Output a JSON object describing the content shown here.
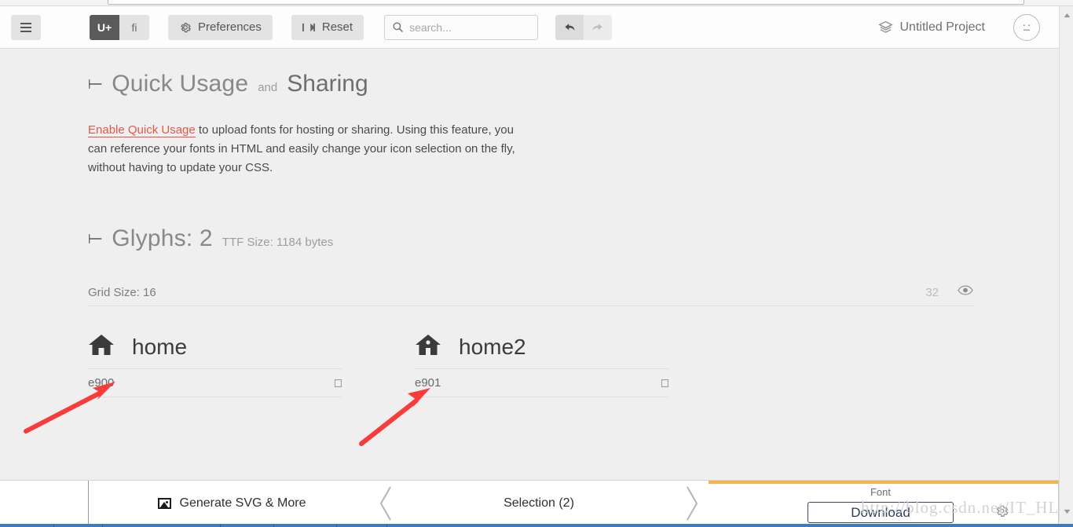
{
  "toolbar": {
    "menu_icon": "hamburger-icon",
    "segment": [
      {
        "label": "U+",
        "active": true
      },
      {
        "label": "fi",
        "active": false
      }
    ],
    "preferences_label": "Preferences",
    "preferences_icon": "gear-icon",
    "reset_label": "Reset",
    "reset_icon": "reset-icon",
    "search": {
      "placeholder": "search...",
      "value": "",
      "icon": "search-icon"
    },
    "undo_icon": "undo-arrow-icon",
    "redo_icon": "redo-arrow-icon",
    "project_name": "Untitled Project",
    "project_icon": "layers-icon",
    "avatar_icon": "neutral-face-icon"
  },
  "quick_usage": {
    "chevron": "chevron-down-icon",
    "title": "Quick Usage",
    "conjunction": "and",
    "title2": "Sharing",
    "link_text": "Enable Quick Usage",
    "body_text": " to upload fonts for hosting or sharing. Using this feature, you can reference your fonts in HTML and easily change your icon selection on the fly, without having to update your CSS."
  },
  "glyphs": {
    "chevron": "chevron-down-icon",
    "title": "Glyphs: 2",
    "ttf_size": "TTF Size: 1184 bytes",
    "grid_size_label": "Grid Size: 16",
    "grid_size_value": "32",
    "eye_icon": "eye-icon",
    "items": [
      {
        "icon": "home-icon",
        "name": "home",
        "code": "e900"
      },
      {
        "icon": "home-icon",
        "name": "home2",
        "code": "e901"
      }
    ]
  },
  "bottom_bar": {
    "generate_label": "Generate SVG & More",
    "generate_icon": "image-icon",
    "selection_label": "Selection (2)",
    "font_label": "Font",
    "download_label": "Download",
    "settings_icon": "gear-icon",
    "accent_color": "#f5b14a"
  },
  "watermark": {
    "text": "http://blog.csdn.net/IT_HLM"
  },
  "scrollbar": {
    "up_icon": "triangle-up-icon",
    "down_icon": "triangle-down-icon"
  },
  "annotations": {
    "arrow_color": "#f83b3b",
    "arrows": [
      {
        "name": "arrow-to-code-e900"
      },
      {
        "name": "arrow-to-code-e901"
      }
    ]
  }
}
